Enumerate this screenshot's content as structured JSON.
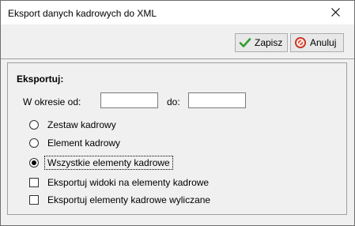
{
  "window": {
    "title": "Eksport danych kadrowych do XML",
    "close_icon": "close-icon"
  },
  "toolbar": {
    "save_label": "Zapisz",
    "save_icon": "check-icon",
    "save_icon_color": "#2e9e2e",
    "cancel_label": "Anuluj",
    "cancel_icon": "cancel-icon",
    "cancel_icon_color": "#d23a2a"
  },
  "export": {
    "section_label": "Eksportuj:",
    "period_from_label": "W okresie od:",
    "period_from_value": "",
    "period_to_label": "do:",
    "period_to_value": "",
    "options": [
      {
        "label": "Zestaw kadrowy",
        "selected": false
      },
      {
        "label": "Element kadrowy",
        "selected": false
      },
      {
        "label": "Wszystkie elementy kadrowe",
        "selected": true
      }
    ],
    "checkboxes": [
      {
        "label": "Eksportuj widoki na elementy kadrowe",
        "checked": false
      },
      {
        "label": "Eksportuj elementy kadrowe wyliczane",
        "checked": false
      }
    ]
  }
}
